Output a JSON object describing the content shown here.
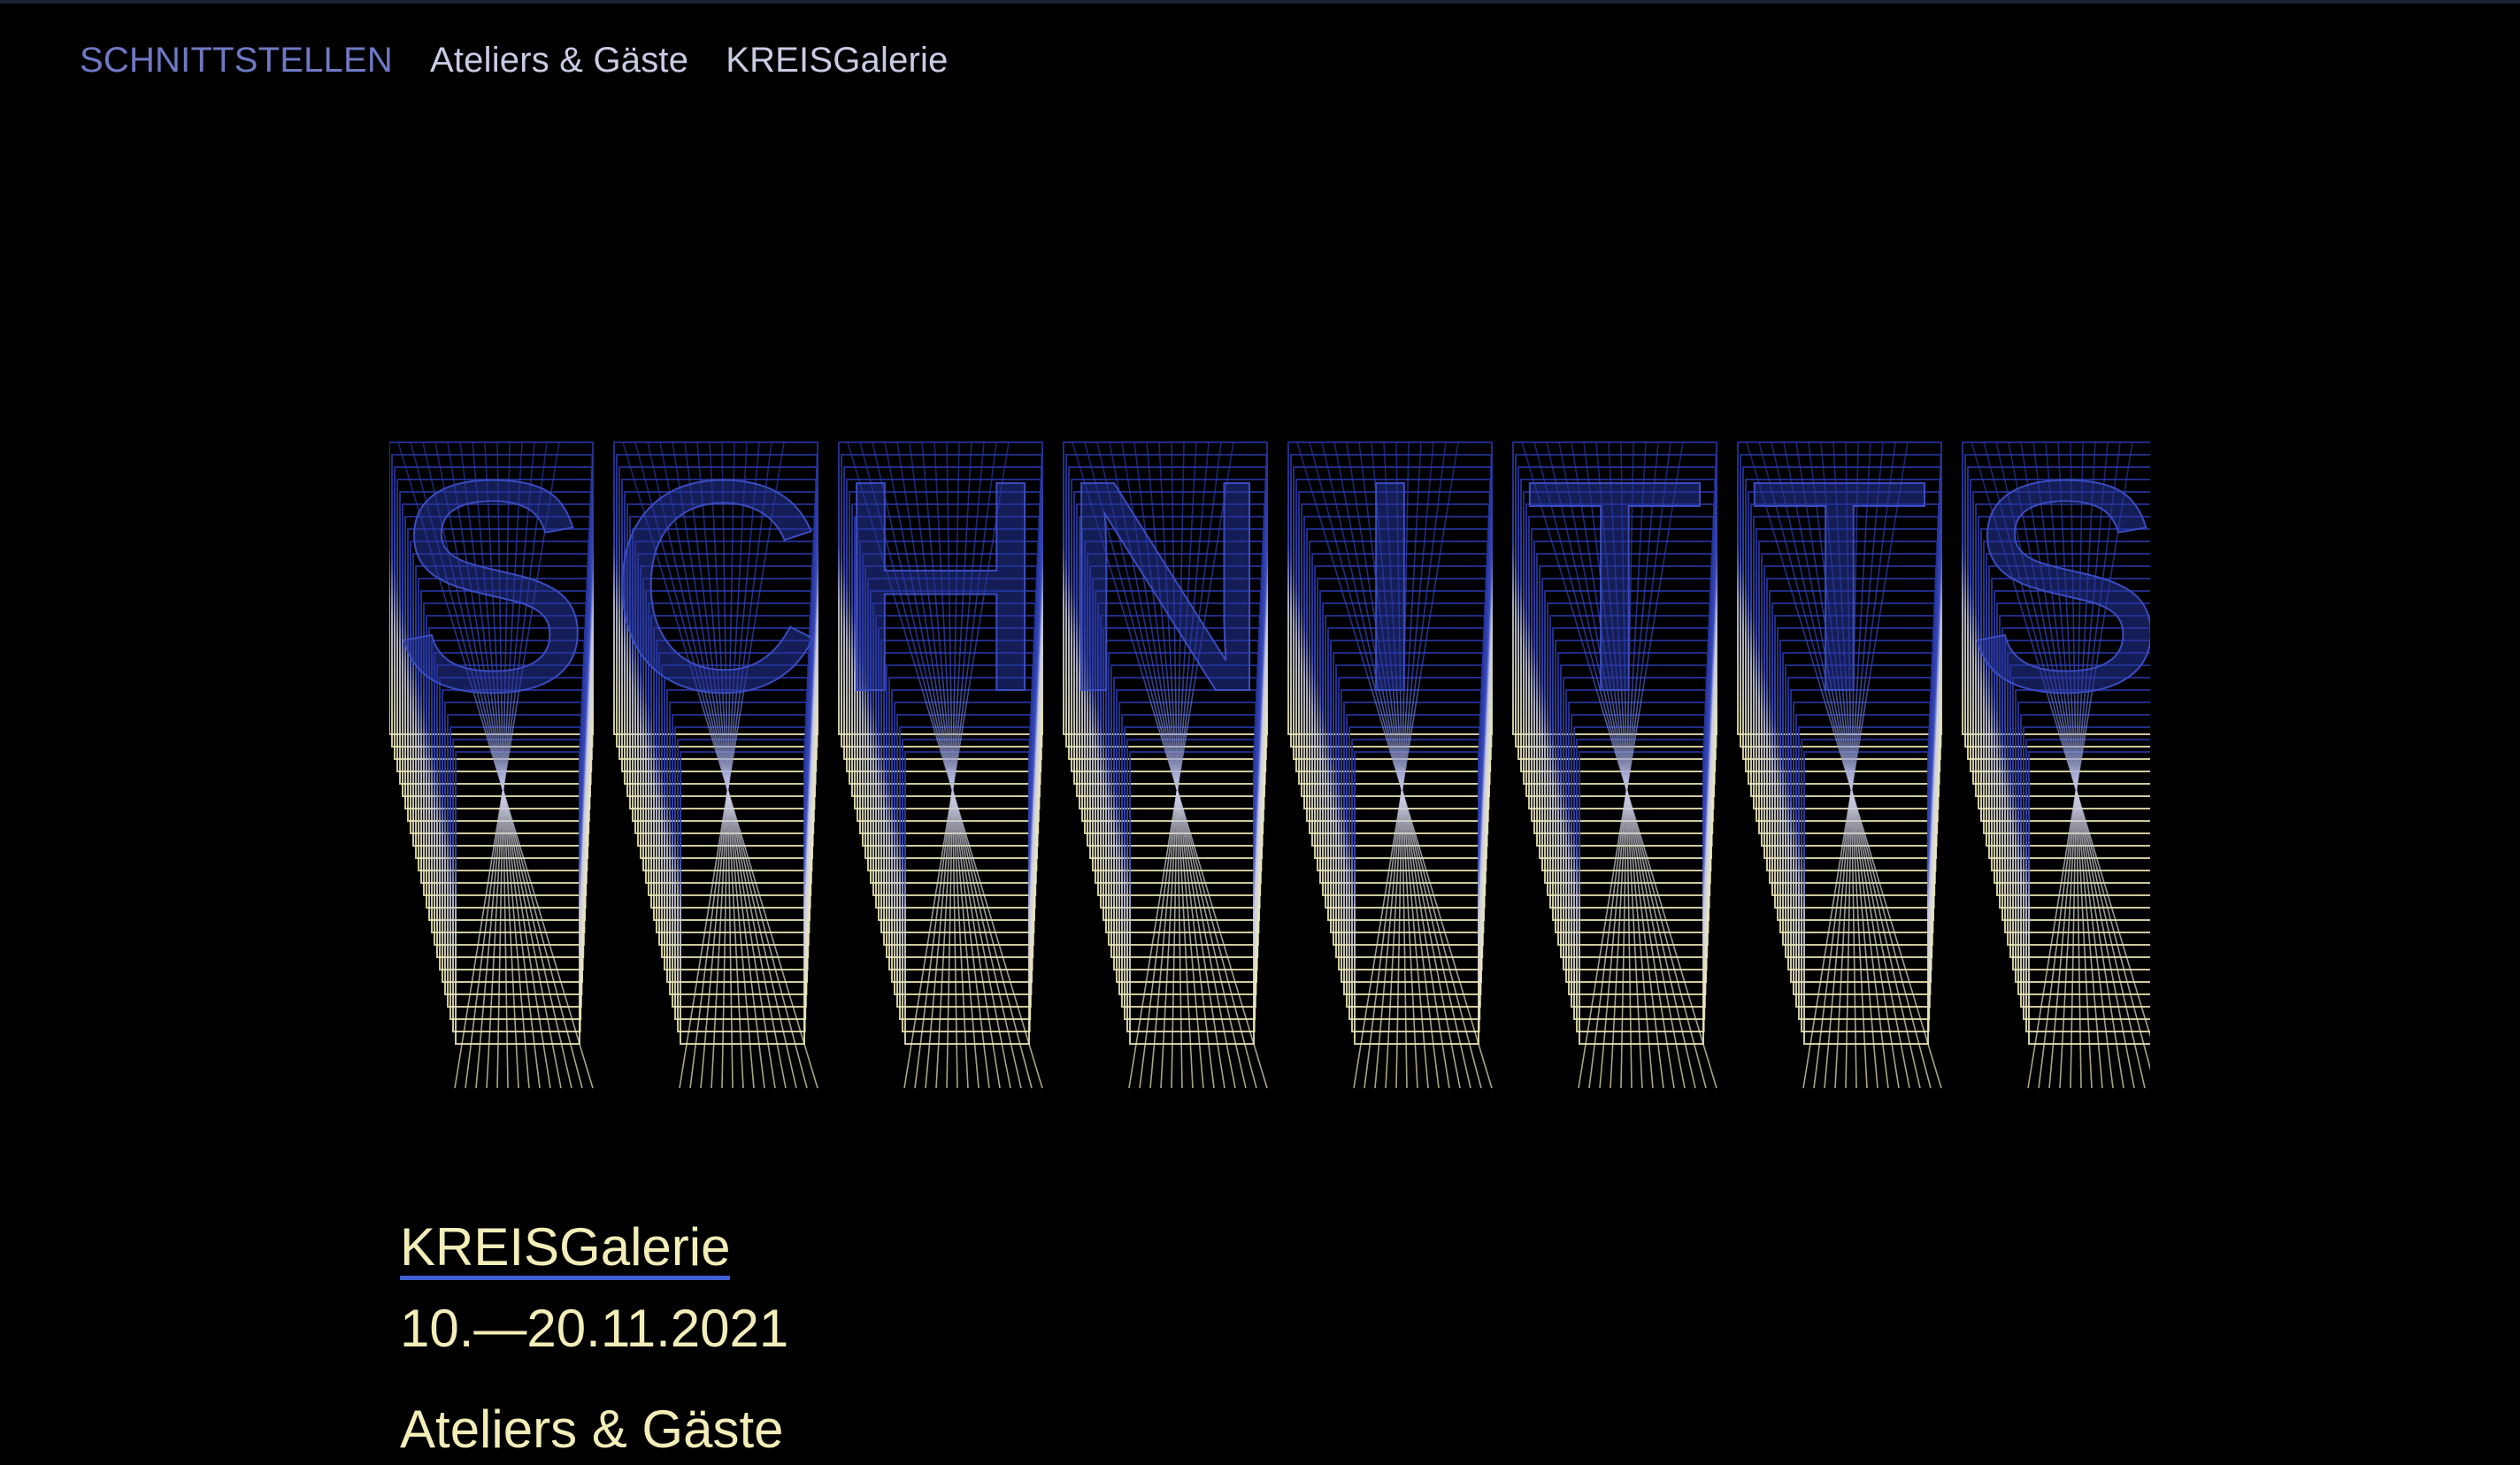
{
  "nav": {
    "items": [
      {
        "label": "SCHNITTSTELLEN",
        "active": true
      },
      {
        "label": "Ateliers & Gäste",
        "active": false
      },
      {
        "label": "KREISGalerie",
        "active": false
      }
    ]
  },
  "hero": {
    "lettering": "SCHNITTSTELLEN",
    "colors": {
      "top": "#26349c",
      "mid": "#c9cbe3",
      "bottom": "#f3eeb8"
    }
  },
  "event": {
    "venue_link": "KREISGalerie",
    "dates": "10.—20.11.2021",
    "next_heading": "Ateliers & Gäste"
  },
  "colors": {
    "background": "#000000",
    "nav_active": "#6f79c4",
    "nav_text": "#c9cbe3",
    "text_cream": "#f3eeb8",
    "link_underline": "#3f5fd6"
  }
}
